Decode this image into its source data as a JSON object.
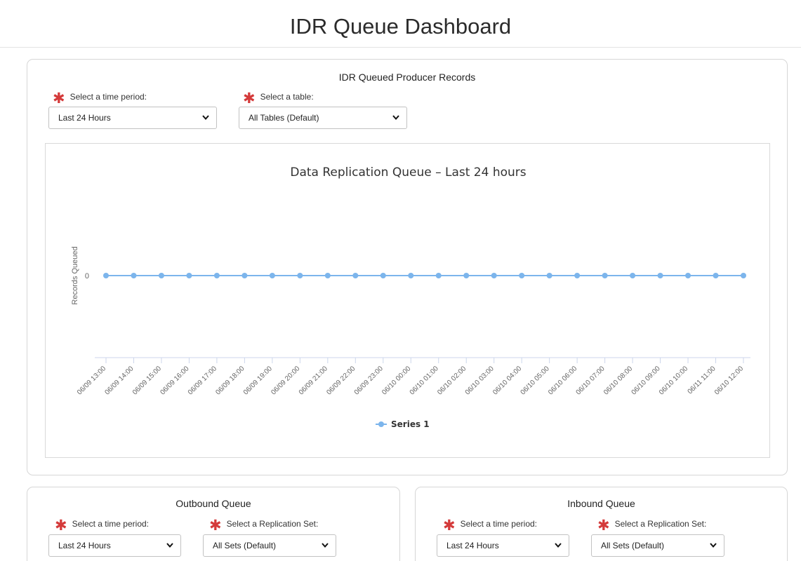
{
  "header": {
    "page_title": "IDR Queue Dashboard"
  },
  "producer_card": {
    "title": "IDR Queued Producer Records",
    "time_period_label": "Select a time period:",
    "time_period_value": "Last 24 Hours",
    "table_label": "Select a table:",
    "table_value": "All Tables (Default)"
  },
  "outbound_card": {
    "title": "Outbound Queue",
    "time_period_label": "Select a time period:",
    "time_period_value": "Last 24 Hours",
    "replication_set_label": "Select a Replication Set:",
    "replication_set_value": "All Sets (Default)"
  },
  "inbound_card": {
    "title": "Inbound Queue",
    "time_period_label": "Select a time period:",
    "time_period_value": "Last 24 Hours",
    "replication_set_label": "Select a Replication Set:",
    "replication_set_value": "All Sets (Default)"
  },
  "colors": {
    "series": "#7cb5ec",
    "required_asterisk": "#d43a3a",
    "axis_line": "#ccd6eb"
  },
  "chart_data": {
    "type": "line",
    "title": "Data Replication Queue – Last 24 hours",
    "xlabel": "",
    "ylabel": "Records Queued",
    "yticks": [
      "0"
    ],
    "legend_position": "bottom-center",
    "grid": false,
    "x": [
      "06/09 13:00",
      "06/09 14:00",
      "06/09 15:00",
      "06/09 16:00",
      "06/09 17:00",
      "06/09 18:00",
      "06/09 19:00",
      "06/09 20:00",
      "06/09 21:00",
      "06/09 22:00",
      "06/09 23:00",
      "06/10 00:00",
      "06/10 01:00",
      "06/10 02:00",
      "06/10 03:00",
      "06/10 04:00",
      "06/10 05:00",
      "06/10 06:00",
      "06/10 07:00",
      "06/10 08:00",
      "06/10 09:00",
      "06/10 10:00",
      "06/11 11:00",
      "06/10 12:00"
    ],
    "series": [
      {
        "name": "Series 1",
        "values": [
          0,
          0,
          0,
          0,
          0,
          0,
          0,
          0,
          0,
          0,
          0,
          0,
          0,
          0,
          0,
          0,
          0,
          0,
          0,
          0,
          0,
          0,
          0,
          0
        ]
      }
    ]
  }
}
